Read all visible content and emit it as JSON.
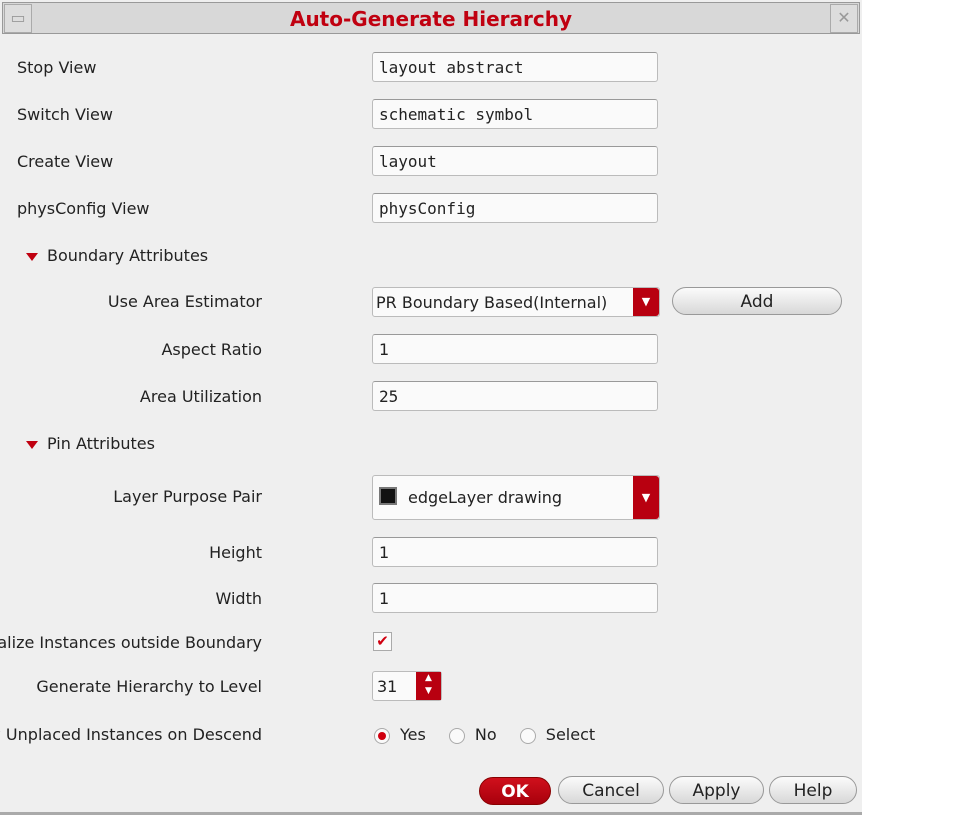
{
  "window": {
    "title": "Auto-Generate Hierarchy",
    "minimize_icon": "minimize-icon",
    "close_icon": "close-icon"
  },
  "views": {
    "stop_view": {
      "label": "Stop View",
      "value": "layout abstract"
    },
    "switch_view": {
      "label": "Switch View",
      "value": "schematic symbol"
    },
    "create_view": {
      "label": "Create View",
      "value": "layout"
    },
    "physconfig_view": {
      "label": "physConfig View",
      "value": "physConfig"
    }
  },
  "boundary": {
    "section": "Boundary Attributes",
    "area_estimator": {
      "label": "Use Area Estimator",
      "value": "PR Boundary Based(Internal)"
    },
    "add_label": "Add",
    "aspect_ratio": {
      "label": "Aspect Ratio",
      "value": "1"
    },
    "area_utilization": {
      "label": "Area Utilization",
      "value": "25"
    }
  },
  "pin": {
    "section": "Pin Attributes",
    "lpp": {
      "label": "Layer Purpose Pair",
      "value": "edgeLayer drawing"
    },
    "height": {
      "label": "Height",
      "value": "1"
    },
    "width": {
      "label": "Width",
      "value": "1"
    }
  },
  "init_instances": {
    "label": "Initialize Instances outside Boundary",
    "checked": true
  },
  "hierarchy_level": {
    "label": "Generate Hierarchy to Level",
    "value": "31"
  },
  "show_unplaced": {
    "label": "Show Unplaced Instances on Descend",
    "options": [
      "Yes",
      "No",
      "Select"
    ],
    "selected": "Yes"
  },
  "buttons": {
    "ok": "OK",
    "cancel": "Cancel",
    "apply": "Apply",
    "help": "Help"
  },
  "colors": {
    "accent": "#c00010"
  }
}
